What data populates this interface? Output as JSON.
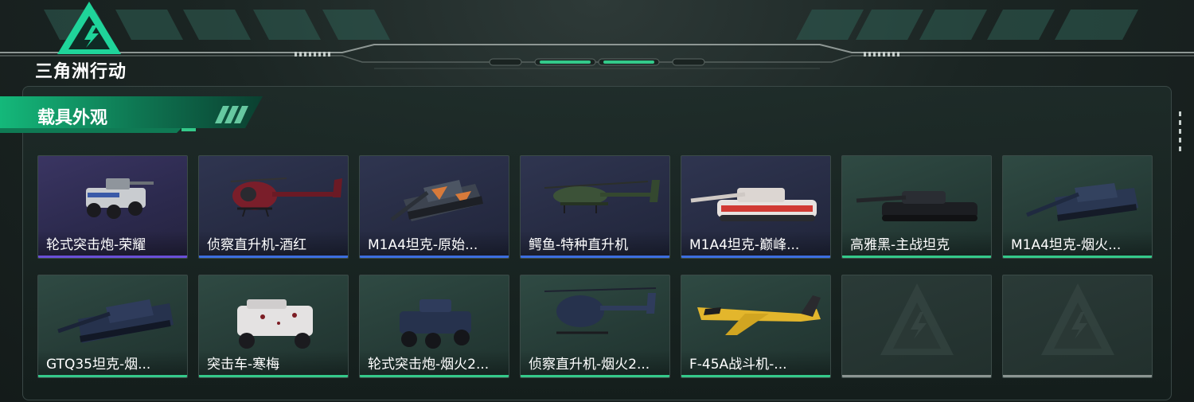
{
  "app": {
    "logo_text": "三角洲行动"
  },
  "section": {
    "title": "载具外观"
  },
  "colors": {
    "accent_green": "#34c98a",
    "rarity_purple": "#6a4fd8",
    "rarity_blue": "#3c6ee0",
    "rarity_green": "#34c98a",
    "empty_gray": "#8c9592"
  },
  "vehicles": [
    {
      "label": "轮式突击炮-荣耀",
      "rarity": "purple",
      "icon": "armored-car-icon"
    },
    {
      "label": "侦察直升机-酒红",
      "rarity": "blue",
      "icon": "scout-helicopter-icon"
    },
    {
      "label": "M1A4坦克-原始...",
      "rarity": "blue",
      "icon": "tank-icon"
    },
    {
      "label": "鳄鱼-特种直升机",
      "rarity": "blue",
      "icon": "attack-helicopter-icon"
    },
    {
      "label": "M1A4坦克-巅峰...",
      "rarity": "blue",
      "icon": "tank-icon"
    },
    {
      "label": "高雅黑-主战坦克",
      "rarity": "green",
      "icon": "tank-icon"
    },
    {
      "label": "M1A4坦克-烟火...",
      "rarity": "green",
      "icon": "tank-icon"
    },
    {
      "label": "GTQ35坦克-烟...",
      "rarity": "green",
      "icon": "tank-icon"
    },
    {
      "label": "突击车-寒梅",
      "rarity": "green",
      "icon": "assault-vehicle-icon"
    },
    {
      "label": "轮式突击炮-烟火2...",
      "rarity": "green",
      "icon": "armored-car-icon"
    },
    {
      "label": "侦察直升机-烟火2...",
      "rarity": "green",
      "icon": "scout-helicopter-icon"
    },
    {
      "label": "F-45A战斗机-...",
      "rarity": "green",
      "icon": "fighter-jet-icon"
    },
    {
      "label": "",
      "rarity": "empty",
      "icon": "delta-logo-placeholder-icon"
    },
    {
      "label": "",
      "rarity": "empty",
      "icon": "delta-logo-placeholder-icon"
    }
  ]
}
